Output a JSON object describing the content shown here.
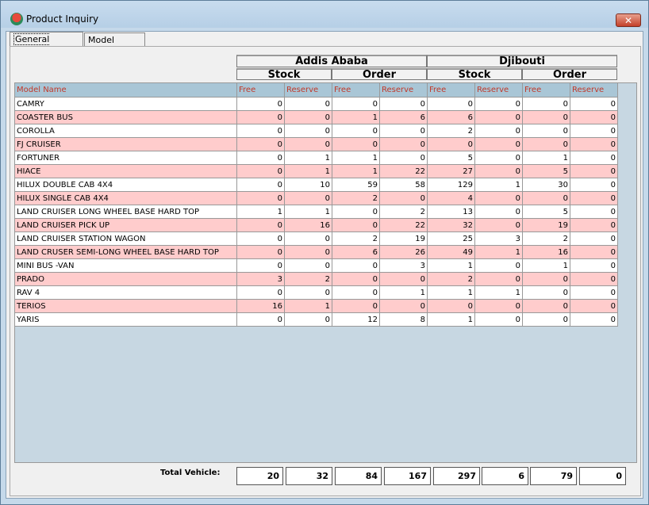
{
  "window": {
    "title": "Product Inquiry",
    "close_label": "✕"
  },
  "tabs": [
    {
      "label": "General Enquiry"
    },
    {
      "label": "Model Enquiry"
    }
  ],
  "groups": [
    {
      "label": "Addis Ababa",
      "stock": "Stock",
      "order": "Order"
    },
    {
      "label": "Djibouti",
      "stock": "Stock",
      "order": "Order"
    }
  ],
  "columns": [
    "Model Name",
    "Free",
    "Reserve",
    "Free",
    "Reserve",
    "Free",
    "Reserve",
    "Free",
    "Reserve"
  ],
  "rows": [
    {
      "model": "CAMRY",
      "v": [
        "0",
        "0",
        "0",
        "0",
        "0",
        "0",
        "0",
        "0"
      ]
    },
    {
      "model": "COASTER BUS",
      "v": [
        "0",
        "0",
        "1",
        "6",
        "6",
        "0",
        "0",
        "0"
      ]
    },
    {
      "model": "COROLLA",
      "v": [
        "0",
        "0",
        "0",
        "0",
        "2",
        "0",
        "0",
        "0"
      ]
    },
    {
      "model": "FJ CRUISER",
      "v": [
        "0",
        "0",
        "0",
        "0",
        "0",
        "0",
        "0",
        "0"
      ]
    },
    {
      "model": "FORTUNER",
      "v": [
        "0",
        "1",
        "1",
        "0",
        "5",
        "0",
        "1",
        "0"
      ]
    },
    {
      "model": "HIACE",
      "v": [
        "0",
        "1",
        "1",
        "22",
        "27",
        "0",
        "5",
        "0"
      ]
    },
    {
      "model": "HILUX DOUBLE CAB 4X4",
      "v": [
        "0",
        "10",
        "59",
        "58",
        "129",
        "1",
        "30",
        "0"
      ]
    },
    {
      "model": "HILUX SINGLE CAB 4X4",
      "v": [
        "0",
        "0",
        "2",
        "0",
        "4",
        "0",
        "0",
        "0"
      ]
    },
    {
      "model": "LAND CRUISER LONG WHEEL BASE HARD TOP",
      "v": [
        "1",
        "1",
        "0",
        "2",
        "13",
        "0",
        "5",
        "0"
      ]
    },
    {
      "model": "LAND CRUISER PICK UP",
      "v": [
        "0",
        "16",
        "0",
        "22",
        "32",
        "0",
        "19",
        "0"
      ]
    },
    {
      "model": "LAND CRUISER STATION WAGON",
      "v": [
        "0",
        "0",
        "2",
        "19",
        "25",
        "3",
        "2",
        "0"
      ]
    },
    {
      "model": "LAND CRUSER SEMI-LONG WHEEL BASE HARD TOP",
      "v": [
        "0",
        "0",
        "6",
        "26",
        "49",
        "1",
        "16",
        "0"
      ]
    },
    {
      "model": "MINI BUS -VAN",
      "v": [
        "0",
        "0",
        "0",
        "3",
        "1",
        "0",
        "1",
        "0"
      ]
    },
    {
      "model": "PRADO",
      "v": [
        "3",
        "2",
        "0",
        "0",
        "2",
        "0",
        "0",
        "0"
      ]
    },
    {
      "model": "RAV 4",
      "v": [
        "0",
        "0",
        "0",
        "1",
        "1",
        "1",
        "0",
        "0"
      ]
    },
    {
      "model": "TERIOS",
      "v": [
        "16",
        "1",
        "0",
        "0",
        "0",
        "0",
        "0",
        "0"
      ]
    },
    {
      "model": "YARIS",
      "v": [
        "0",
        "0",
        "12",
        "8",
        "1",
        "0",
        "0",
        "0"
      ]
    }
  ],
  "totals": {
    "label": "Total Vehicle:",
    "values": [
      "20",
      "32",
      "84",
      "167",
      "297",
      "6",
      "79",
      "0"
    ]
  }
}
